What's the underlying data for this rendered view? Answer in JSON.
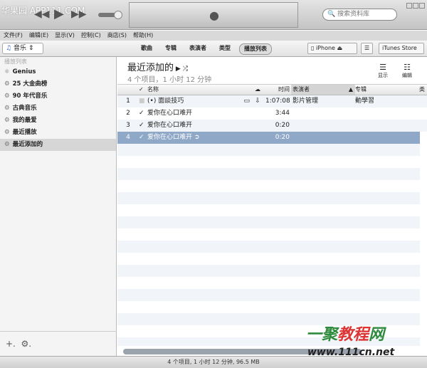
{
  "watermark_top": "华果园 APP111.COM",
  "watermark_logo": {
    "cn": "一聚教程网",
    "url": "www.111cn.net"
  },
  "toolbar": {
    "search_placeholder": "搜索资料库"
  },
  "menu": [
    "文件(F)",
    "编辑(E)",
    "显示(V)",
    "控制(C)",
    "商店(S)",
    "帮助(H)"
  ],
  "nav": {
    "library": "音乐",
    "tabs": [
      "歌曲",
      "专辑",
      "表演者",
      "类型",
      "播放列表"
    ],
    "active_tab": "播放列表",
    "device": "iPhone",
    "store": "iTunes Store"
  },
  "sidebar": {
    "header": "播放列表",
    "items": [
      "Genius",
      "25 大金曲榜",
      "90 年代音乐",
      "古典音乐",
      "我的最爱",
      "最近播放",
      "最近添加的"
    ],
    "selected": "最近添加的"
  },
  "main": {
    "title": "最近添加的",
    "subtitle": "4 个项目，1 小时 12 分钟",
    "show_label": "显示",
    "edit_label": "编辑",
    "columns": [
      "✓",
      "名称",
      "时间",
      "表演者",
      "专辑",
      "类"
    ],
    "rows": [
      {
        "num": "1",
        "checked": false,
        "name": "面談技巧",
        "time": "1:07:08",
        "artist": "影片管理",
        "album": "動學習"
      },
      {
        "num": "2",
        "checked": true,
        "name": "爱你在心口难开",
        "time": "3:44",
        "artist": "",
        "album": ""
      },
      {
        "num": "3",
        "checked": true,
        "name": "爱你在心口难开",
        "time": "0:20",
        "artist": "",
        "album": ""
      },
      {
        "num": "4",
        "checked": true,
        "name": "爱你在心口难开",
        "time": "0:20",
        "artist": "",
        "album": ""
      }
    ],
    "selected_row": "4"
  },
  "status": "4 个项目, 1 小时 12 分钟, 96.5 MB"
}
